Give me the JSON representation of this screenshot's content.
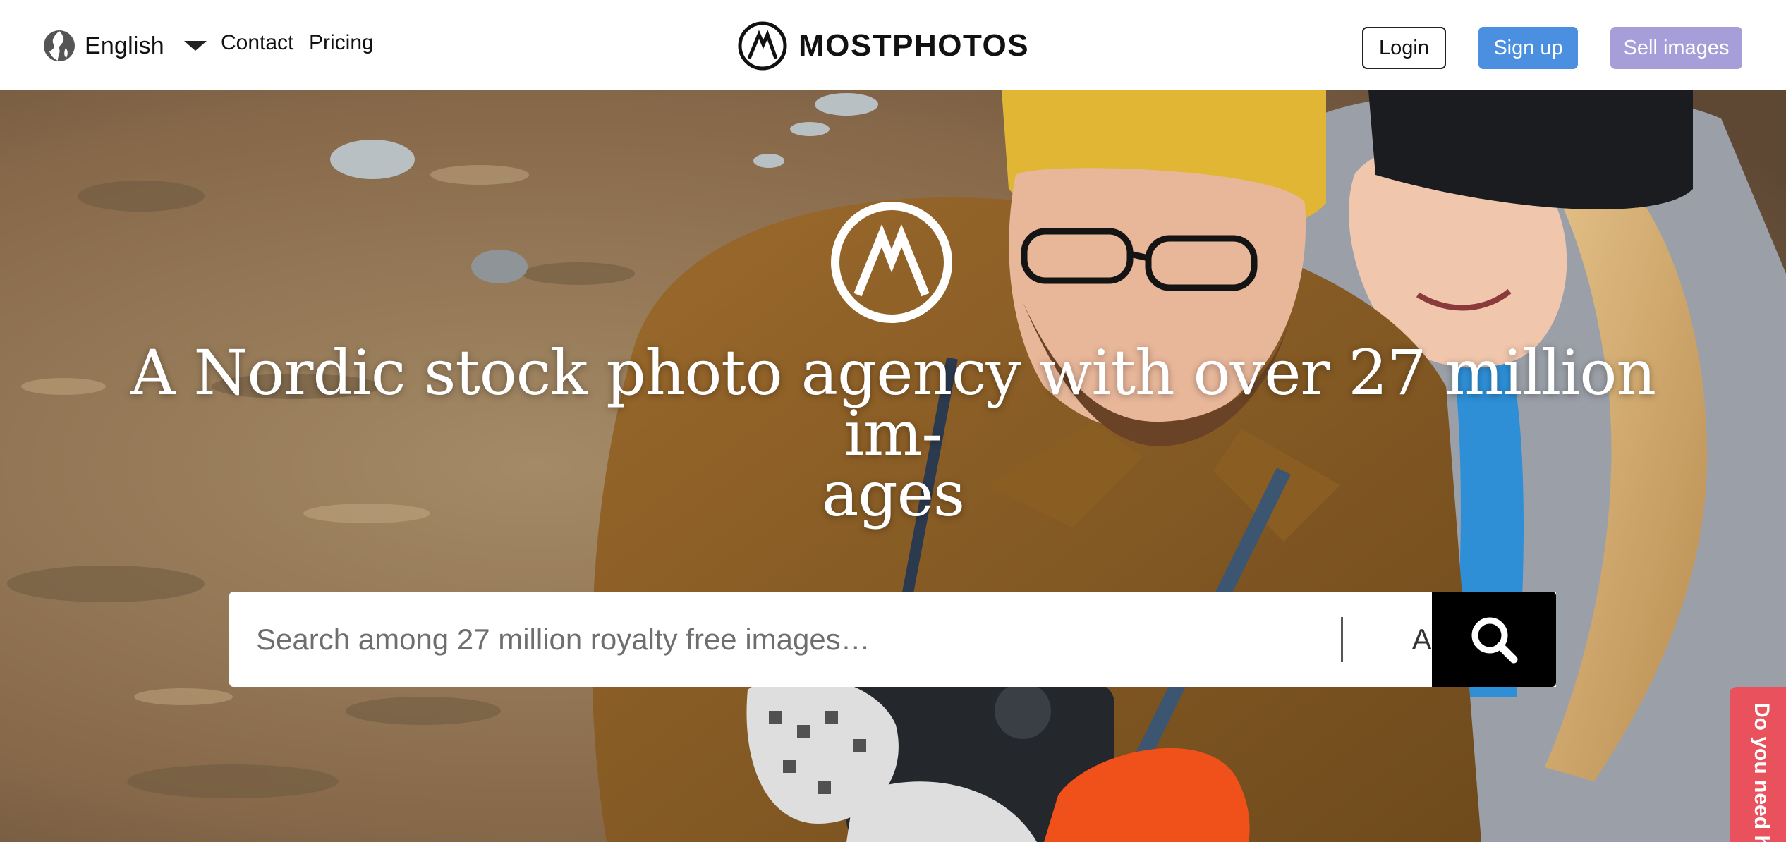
{
  "header": {
    "language": {
      "icon": "globe-icon",
      "label": "English",
      "caret": "chevron-down-icon"
    },
    "nav": {
      "contact": "Contact",
      "pricing": "Pricing"
    },
    "brand": {
      "icon": "mostphotos-logo",
      "name": "MOSTPHOTOS"
    },
    "buttons": {
      "login": "Login",
      "signup": "Sign up",
      "sell": "Sell images"
    }
  },
  "hero": {
    "logo_icon": "mostphotos-logo",
    "title_line1": "A Nordic stock photo agency with over 27 million im-",
    "title_line2": "ages",
    "search": {
      "placeholder": "Search among 27 million royalty free images…",
      "category": "All",
      "button_icon": "search-icon"
    }
  },
  "help_tab": {
    "label": "Do you need h"
  },
  "colors": {
    "signup": "#4a8fe0",
    "sell": "#a69ed8",
    "help_tab": "#e9515c",
    "search_button": "#000000"
  }
}
